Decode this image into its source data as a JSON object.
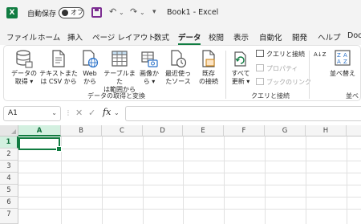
{
  "titlebar": {
    "logo": "X",
    "autosave_label": "自動保存",
    "autosave_state": "オフ",
    "undo_glyph": "↶",
    "redo_glyph": "↷",
    "customize_glyph": "▾",
    "title": "Book1 - Excel"
  },
  "menu": {
    "tabs": [
      "ファイル",
      "ホーム",
      "挿入",
      "ページ レイアウト",
      "数式",
      "データ",
      "校閲",
      "表示",
      "自動化",
      "開発",
      "ヘルプ",
      "Doc"
    ],
    "active": "データ"
  },
  "ribbon": {
    "get_data": [
      "データの",
      "取得 ▾"
    ],
    "from_text_csv": [
      "テキストまた",
      "は CSV から"
    ],
    "from_web": [
      "Web",
      "から"
    ],
    "from_table": [
      "テーブルまた",
      "は範囲から"
    ],
    "from_picture": [
      "画像か",
      "ら ▾"
    ],
    "recent_sources": [
      "最近使っ",
      "たソース"
    ],
    "existing_connections": [
      "既存",
      "の接続"
    ],
    "group1_label": "データの取得と変換",
    "refresh_all": [
      "すべて",
      "更新 ▾"
    ],
    "queries_connections": "クエリと接続",
    "properties": "プロパティ",
    "edit_links": "ブックのリンク",
    "group2_label": "クエリと接続",
    "sort_az": "A↓Z",
    "sort": "並べ替え",
    "group3_label": "並べ"
  },
  "formula_bar": {
    "name_box": "A1",
    "name_dropdown": "⌄",
    "dots": "⋮",
    "cancel": "✕",
    "enter": "✓",
    "fx": "fx",
    "fx_dropdown": "⌄",
    "value": ""
  },
  "sheet": {
    "columns": [
      "A",
      "B",
      "C",
      "D",
      "E",
      "F",
      "G",
      "H"
    ],
    "rows": [
      "1",
      "2",
      "3",
      "4",
      "5",
      "6",
      "7"
    ],
    "active_cell": "A1"
  }
}
